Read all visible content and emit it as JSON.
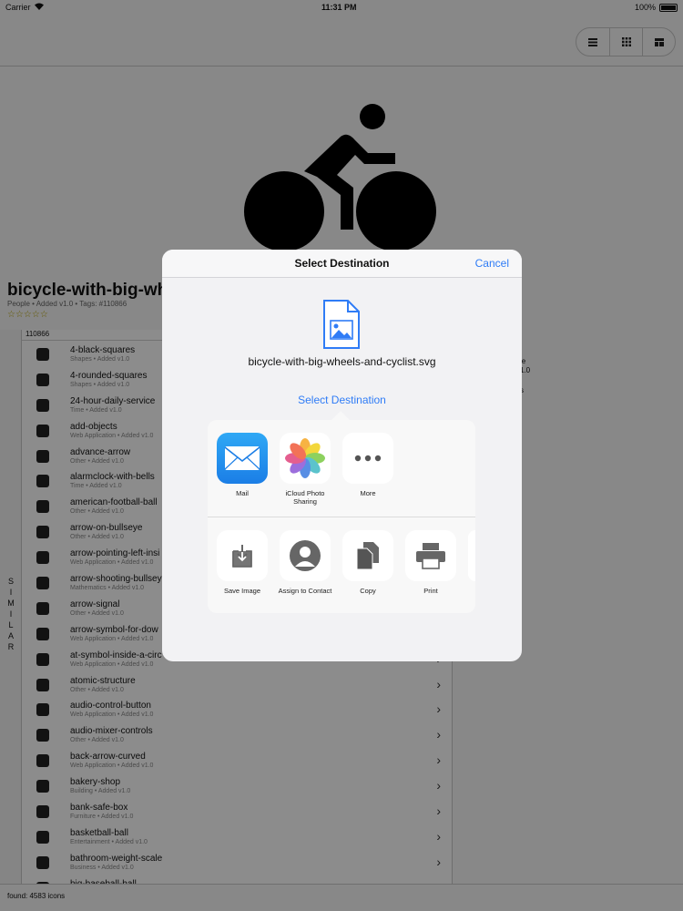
{
  "status_bar": {
    "carrier": "Carrier",
    "time": "11:31 PM",
    "battery": "100%"
  },
  "toolbar": {
    "view_buttons": [
      "list-view",
      "grid-view",
      "detail-view"
    ]
  },
  "icon_detail": {
    "title": "bicycle-with-big-whe",
    "meta": "People • Added v1.0 • Tags: #110866",
    "stars": "☆☆☆☆☆"
  },
  "similar_label": "SIMILAR",
  "list": {
    "header": "110866",
    "items": [
      {
        "name": "4-black-squares",
        "sub": "Shapes • Added v1.0"
      },
      {
        "name": "4-rounded-squares",
        "sub": "Shapes • Added v1.0"
      },
      {
        "name": "24-hour-daily-service",
        "sub": "Time • Added v1.0"
      },
      {
        "name": "add-objects",
        "sub": "Web Application • Added v1.0"
      },
      {
        "name": "advance-arrow",
        "sub": "Other • Added v1.0"
      },
      {
        "name": "alarmclock-with-bells",
        "sub": "Time • Added v1.0"
      },
      {
        "name": "american-football-ball",
        "sub": "Other • Added v1.0"
      },
      {
        "name": "arrow-on-bullseye",
        "sub": "Other • Added v1.0"
      },
      {
        "name": "arrow-pointing-left-insi",
        "sub": "Web Application • Added v1.0"
      },
      {
        "name": "arrow-shooting-bullsey",
        "sub": "Mathematics • Added v1.0"
      },
      {
        "name": "arrow-signal",
        "sub": "Other • Added v1.0"
      },
      {
        "name": "arrow-symbol-for-dow",
        "sub": "Web Application • Added v1.0"
      },
      {
        "name": "at-symbol-inside-a-circ",
        "sub": "Web Application • Added v1.0"
      },
      {
        "name": "atomic-structure",
        "sub": "Other • Added v1.0"
      },
      {
        "name": "audio-control-button",
        "sub": "Web Application • Added v1.0"
      },
      {
        "name": "audio-mixer-controls",
        "sub": "Other • Added v1.0"
      },
      {
        "name": "back-arrow-curved",
        "sub": "Web Application • Added v1.0"
      },
      {
        "name": "bakery-shop",
        "sub": "Building • Added v1.0"
      },
      {
        "name": "bank-safe-box",
        "sub": "Furniture • Added v1.0"
      },
      {
        "name": "basketball-ball",
        "sub": "Entertainment • Added v1.0"
      },
      {
        "name": "bathroom-weight-scale",
        "sub": "Business • Added v1.0"
      },
      {
        "name": "big-baseball-ball",
        "sub": ""
      }
    ]
  },
  "detail_panel": {
    "line1": "le",
    "line2": "1.0",
    "line3": "s"
  },
  "footer": "found: 4583 icons",
  "modal": {
    "title": "Select Destination",
    "cancel": "Cancel",
    "filename": "bicycle-with-big-wheels-and-cyclist.svg",
    "select_link": "Select Destination",
    "apps": [
      {
        "label": "Mail",
        "icon": "mail-icon"
      },
      {
        "label": "iCloud Photo Sharing",
        "icon": "photos-icon"
      },
      {
        "label": "More",
        "icon": "more-icon"
      }
    ],
    "actions": [
      {
        "label": "Save Image",
        "icon": "save-image-icon"
      },
      {
        "label": "Assign to Contact",
        "icon": "contact-icon"
      },
      {
        "label": "Copy",
        "icon": "copy-icon"
      },
      {
        "label": "Print",
        "icon": "print-icon"
      }
    ]
  },
  "colors": {
    "accent": "#2f7cf6",
    "overlay": "rgba(0,0,0,0.45)"
  }
}
